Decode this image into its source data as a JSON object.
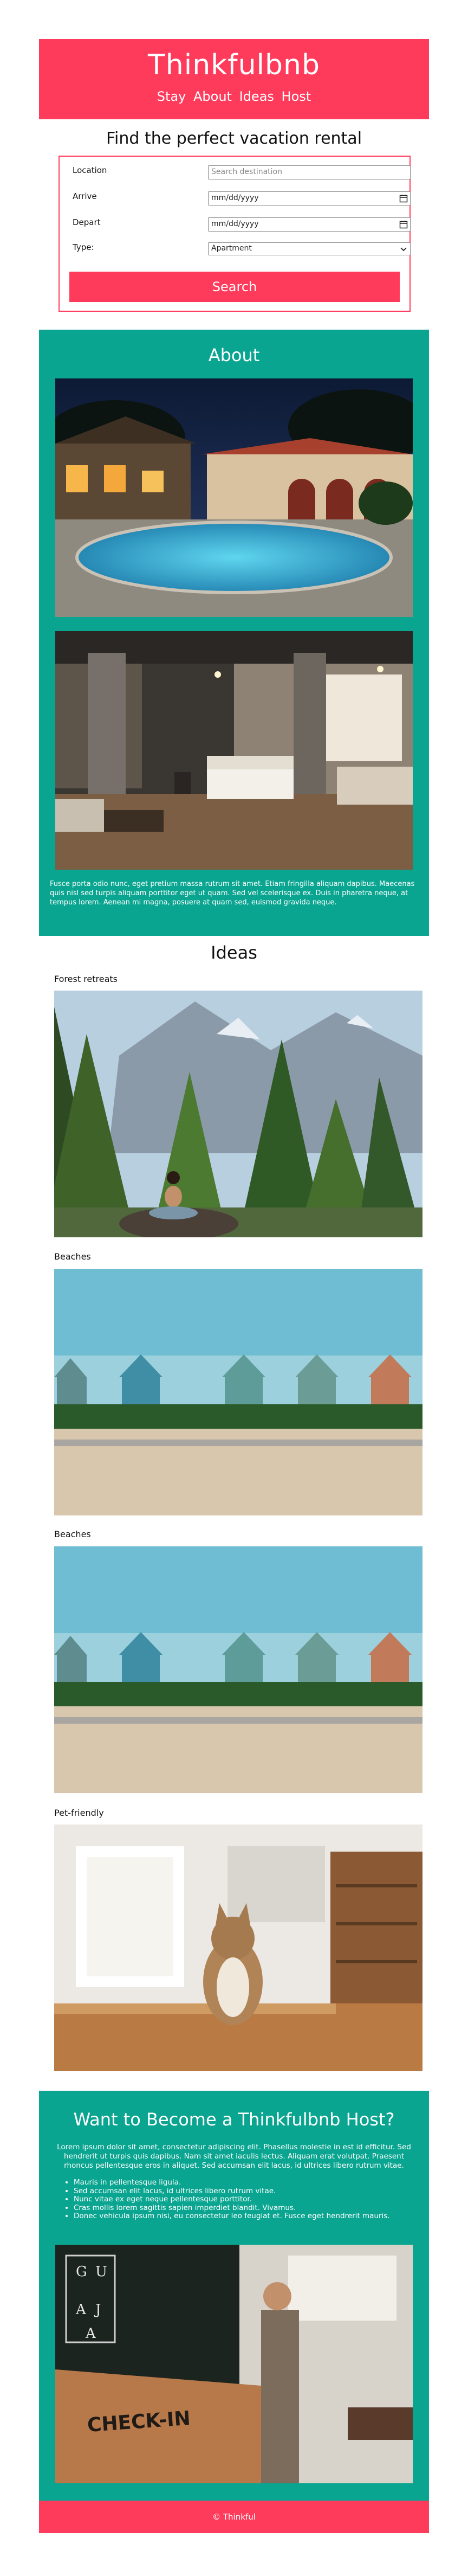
{
  "header": {
    "brand": "Thinkfulbnb",
    "nav": [
      "Stay",
      "About",
      "Ideas",
      "Host"
    ]
  },
  "search": {
    "title": "Find the perfect vacation rental",
    "location_label": "Location",
    "location_placeholder": "Search destination",
    "arrive_label": "Arrive",
    "arrive_value": "mm/dd/yyyy",
    "depart_label": "Depart",
    "depart_value": "mm/dd/yyyy",
    "type_label": "Type:",
    "type_value": "Apartment",
    "button_label": "Search"
  },
  "about": {
    "title": "About",
    "text": "Fusce porta odio nunc, eget pretium massa rutrum sit amet. Etiam fringilla aliquam dapibus. Maecenas quis nisl sed turpis aliquam porttitor eget ut quam. Sed vel scelerisque ex. Duis in pharetra neque, at tempus lorem. Aenean mi magna, posuere at quam sed, euismod gravida neque."
  },
  "ideas": {
    "title": "Ideas",
    "items": [
      {
        "caption": "Forest retreats"
      },
      {
        "caption": "Beaches"
      },
      {
        "caption": "Beaches"
      },
      {
        "caption": "Pet-friendly"
      }
    ]
  },
  "host": {
    "title": "Want to Become a Thinkfulbnb Host?",
    "text": "Lorem ipsum dolor sit amet, consectetur adipiscing elit. Phasellus molestie in est id efficitur. Sed hendrerit ut turpis quis dapibus. Nam sit amet iaculis lectus. Aliquam erat volutpat. Praesent rhoncus pellentesque eros in aliquet. Sed accumsan elit lacus, id ultrices libero rutrum vitae.",
    "list": [
      "Mauris in pellentesque ligula.",
      "Sed accumsan elit lacus, id ultrices libero rutrum vitae.",
      "Nunc vitae ex eget neque pellentesque porttitor.",
      "Cras mollis lorem sagittis sapien imperdiet blandit. Vivamus.",
      "Donec vehicula ipsum nisi, eu consectetur leo feugiat et. Fusce eget hendrerit mauris."
    ],
    "sign_text": [
      "G",
      "U",
      "A",
      "J",
      "A"
    ],
    "counter_text": "CHECK-IN"
  },
  "footer": {
    "text": "© Thinkful"
  },
  "colors": {
    "brand": "#ff3b5c",
    "teal": "#0aa590"
  }
}
